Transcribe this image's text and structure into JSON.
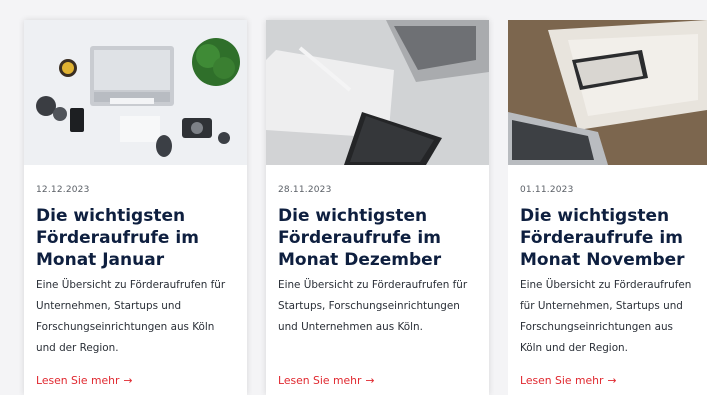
{
  "cards": [
    {
      "date": "12.12.2023",
      "title": "Die wichtigsten Förderaufrufe im Monat Januar",
      "text": "Eine Übersicht zu Förderaufrufen für Unternehmen, Startups und Forschungseinrichtungen aus Köln und der Region.",
      "link_label": "Lesen Sie mehr",
      "link_arrow": "→",
      "image_icon": "laptop-desk-photo"
    },
    {
      "date": "28.11.2023",
      "title": "Die wichtigsten Förderaufrufe im Monat Dezember",
      "text": "Eine Übersicht zu Förderaufrufen für Startups, Forschungseinrichtungen und Unternehmen aus Köln.",
      "link_label": "Lesen Sie mehr",
      "link_arrow": "→",
      "image_icon": "notebook-phone-photo"
    },
    {
      "date": "01.11.2023",
      "title": "Die wichtigsten Förderaufrufe im Monat November",
      "text": "Eine Übersicht zu Förderaufrufen für Unternehmen, Startups und Forschungseinrichtungen aus Köln und der Region.",
      "link_label": "Lesen Sie mehr",
      "link_arrow": "→",
      "image_icon": "laptop-phone-wood-photo"
    }
  ],
  "colors": {
    "title": "#0e1f3f",
    "link": "#e0282f",
    "background": "#f4f4f6"
  }
}
